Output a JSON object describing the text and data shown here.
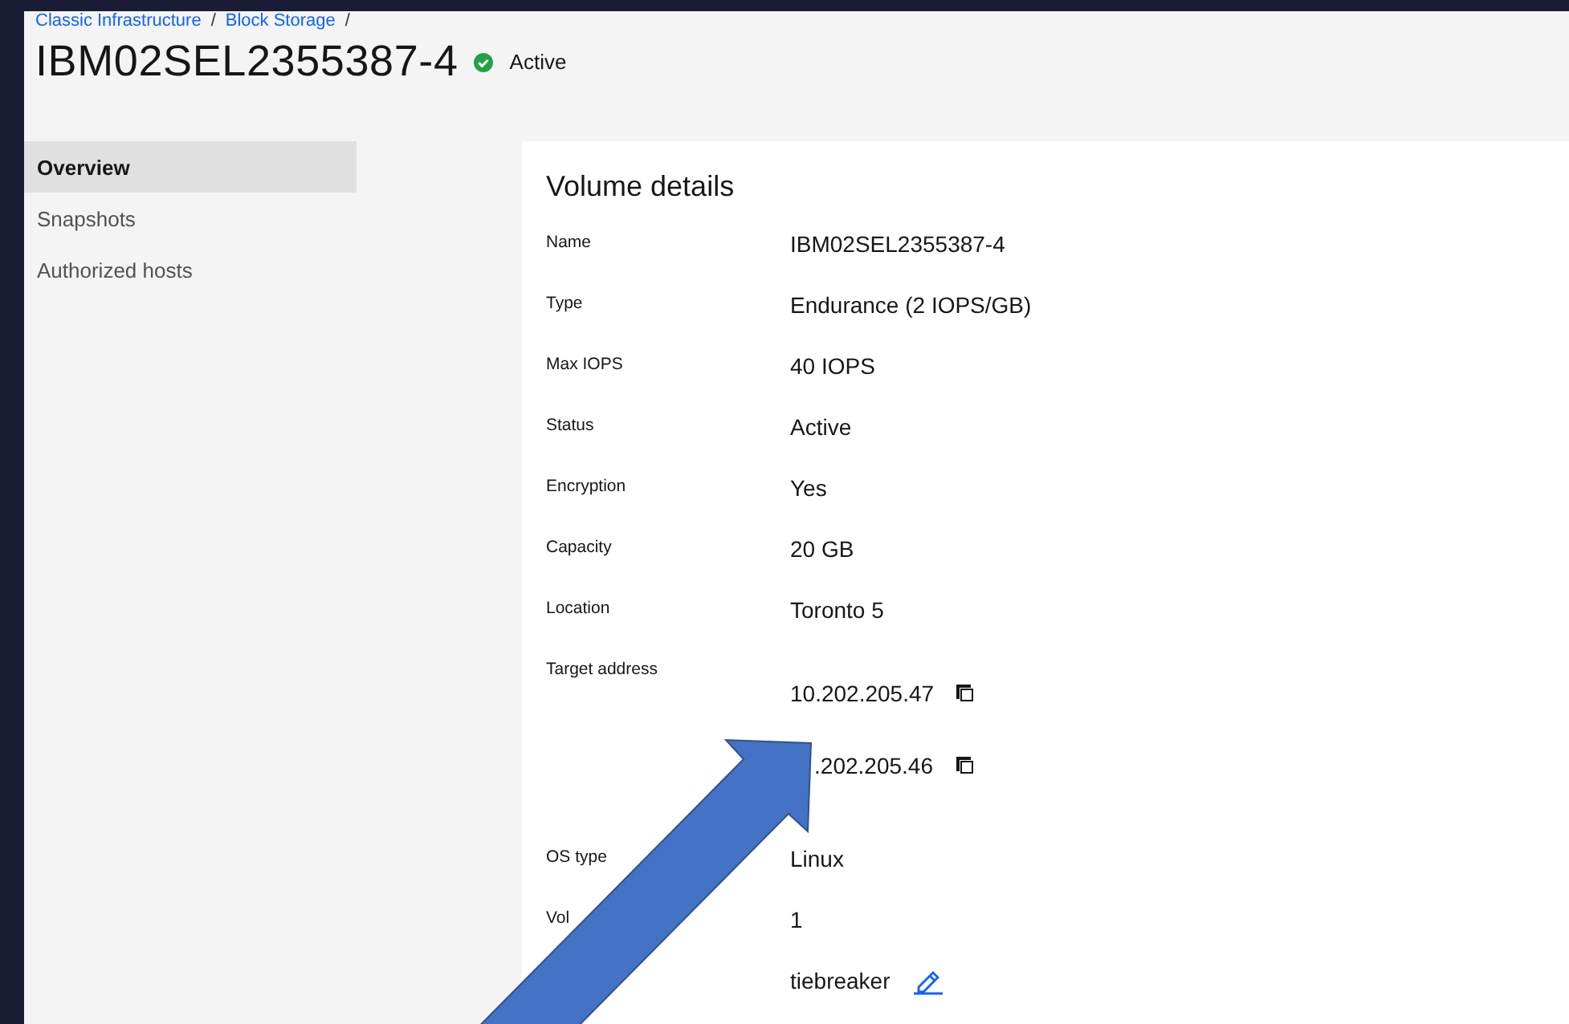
{
  "breadcrumbs": [
    "Classic Infrastructure",
    "Block Storage"
  ],
  "breadcrumb_separator": "/",
  "title": "IBM02SEL2355387-4",
  "status": {
    "label": "Active"
  },
  "sidebar": {
    "items": [
      {
        "label": "Overview",
        "selected": true
      },
      {
        "label": "Snapshots",
        "selected": false
      },
      {
        "label": "Authorized hosts",
        "selected": false
      }
    ]
  },
  "details": {
    "heading": "Volume details",
    "rows": [
      {
        "label": "Name",
        "values": [
          {
            "text": "IBM02SEL2355387-4"
          }
        ]
      },
      {
        "label": "Type",
        "values": [
          {
            "text": "Endurance (2 IOPS/GB)"
          }
        ]
      },
      {
        "label": "Max IOPS",
        "values": [
          {
            "text": "40 IOPS"
          }
        ]
      },
      {
        "label": "Status",
        "values": [
          {
            "text": "Active"
          }
        ]
      },
      {
        "label": "Encryption",
        "values": [
          {
            "text": "Yes"
          }
        ]
      },
      {
        "label": "Capacity",
        "values": [
          {
            "text": "20 GB"
          }
        ]
      },
      {
        "label": "Location",
        "values": [
          {
            "text": "Toronto 5"
          }
        ]
      },
      {
        "label": "Target address",
        "values": [
          {
            "text": "10.202.205.47",
            "kind": "copy"
          },
          {
            "text": ".202.205.46",
            "kind": "copy"
          }
        ]
      },
      {
        "label": "OS type",
        "values": [
          {
            "text": "Linux"
          }
        ]
      },
      {
        "label": "Vol",
        "values": [
          {
            "text": "1"
          }
        ]
      },
      {
        "label": "",
        "values": [
          {
            "text": "tiebreaker",
            "kind": "edit"
          }
        ]
      }
    ]
  }
}
